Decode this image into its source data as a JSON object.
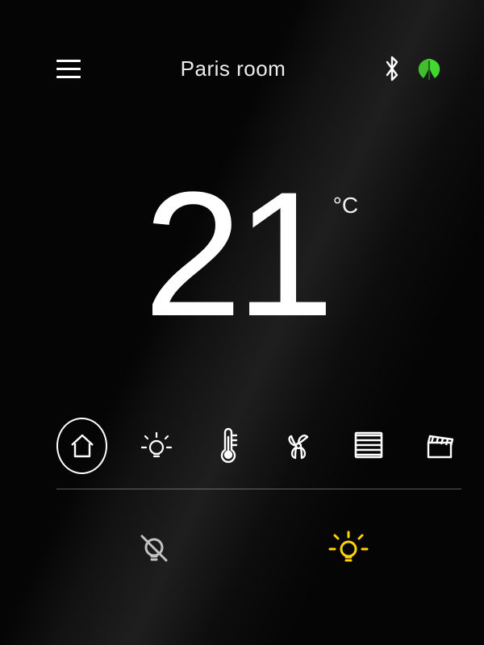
{
  "header": {
    "title": "Paris room",
    "bluetooth_icon": "bluetooth",
    "eco_icon": "leaf",
    "eco_color": "#33cc11"
  },
  "main": {
    "temperature_value": "21",
    "temperature_unit": "°C"
  },
  "nav": {
    "items": [
      {
        "name": "home",
        "selected": true
      },
      {
        "name": "light",
        "selected": false
      },
      {
        "name": "thermometer",
        "selected": false
      },
      {
        "name": "fan",
        "selected": false
      },
      {
        "name": "blinds",
        "selected": false
      },
      {
        "name": "scenes",
        "selected": false
      }
    ]
  },
  "quick": {
    "left": {
      "name": "mute-light",
      "color": "#bdbdbd"
    },
    "right": {
      "name": "light-on",
      "color": "#ffd400"
    }
  }
}
